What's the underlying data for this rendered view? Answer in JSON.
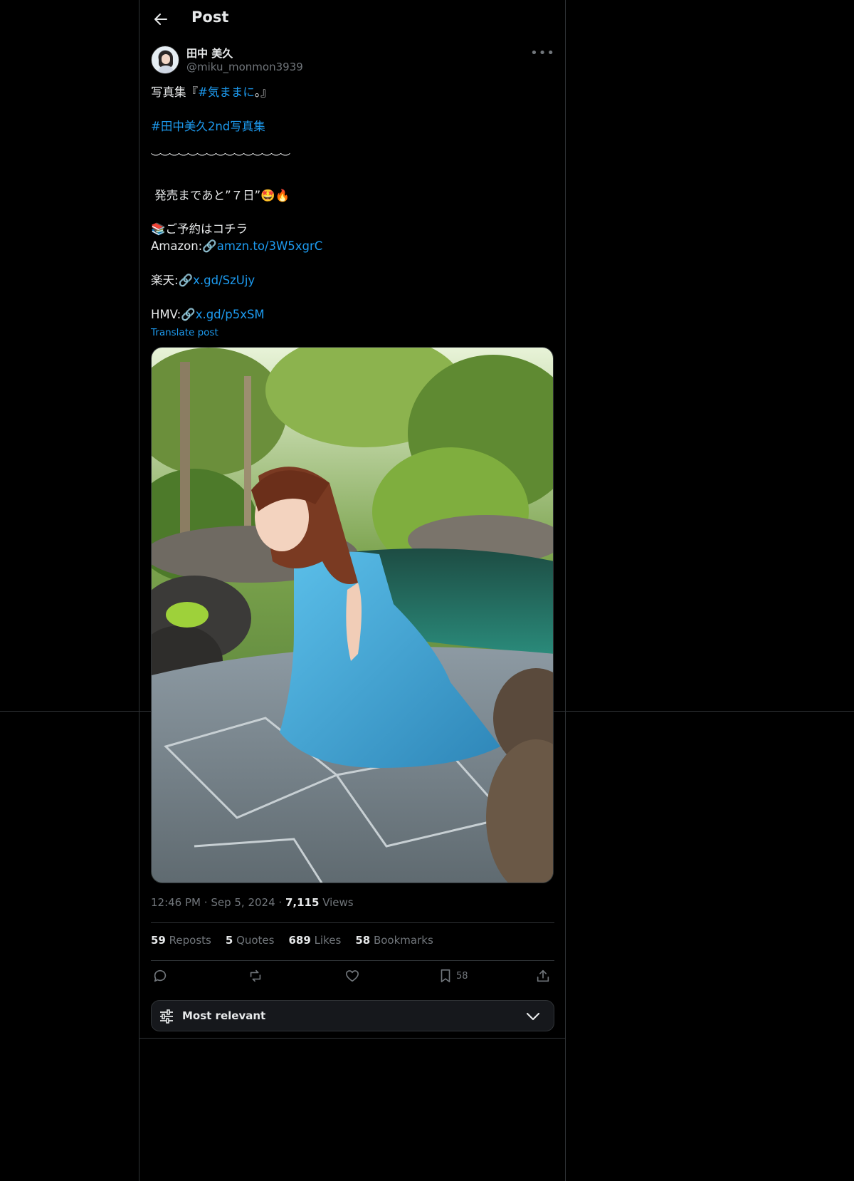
{
  "header": {
    "title": "Post"
  },
  "author": {
    "name": "田中 美久",
    "handle": "@miku_monmon3939"
  },
  "post": {
    "line1_prefix": "写真集『",
    "line1_hashtag": "#気ままに",
    "line1_suffix": "。』",
    "hashtag2": "#田中美久2nd写真集",
    "wave_line": "︶︶︶︶︶︶︶︶︶︶︶︶︶︶︶",
    "countdown": " 発売まであと”７日”",
    "countdown_emoji": "🤩🔥",
    "reserve_emoji": "📚",
    "reserve_text": "ご予約はコチラ",
    "amazon_label": "Amazon:",
    "amazon_link": "amzn.to/3W5xgrC",
    "rakuten_label": "楽天:",
    "rakuten_link": "x.gd/SzUjy",
    "hmv_label": "HMV:",
    "hmv_link": "x.gd/p5xSM",
    "link_emoji": "🔗",
    "translate": "Translate post"
  },
  "meta": {
    "time": "12:46 PM",
    "dot": "·",
    "date": "Sep 5, 2024",
    "views_count": "7,115",
    "views_label": "Views"
  },
  "stats": {
    "reposts_count": "59",
    "reposts_label": "Reposts",
    "quotes_count": "5",
    "quotes_label": "Quotes",
    "likes_count": "689",
    "likes_label": "Likes",
    "bookmarks_count": "58",
    "bookmarks_label": "Bookmarks"
  },
  "actions": {
    "bookmark_count": "58"
  },
  "sort": {
    "label": "Most relevant"
  },
  "colors": {
    "accent": "#1d9bf0",
    "muted": "#71767b",
    "text": "#e7e9ea",
    "background": "#000000",
    "border": "#2f3336"
  }
}
